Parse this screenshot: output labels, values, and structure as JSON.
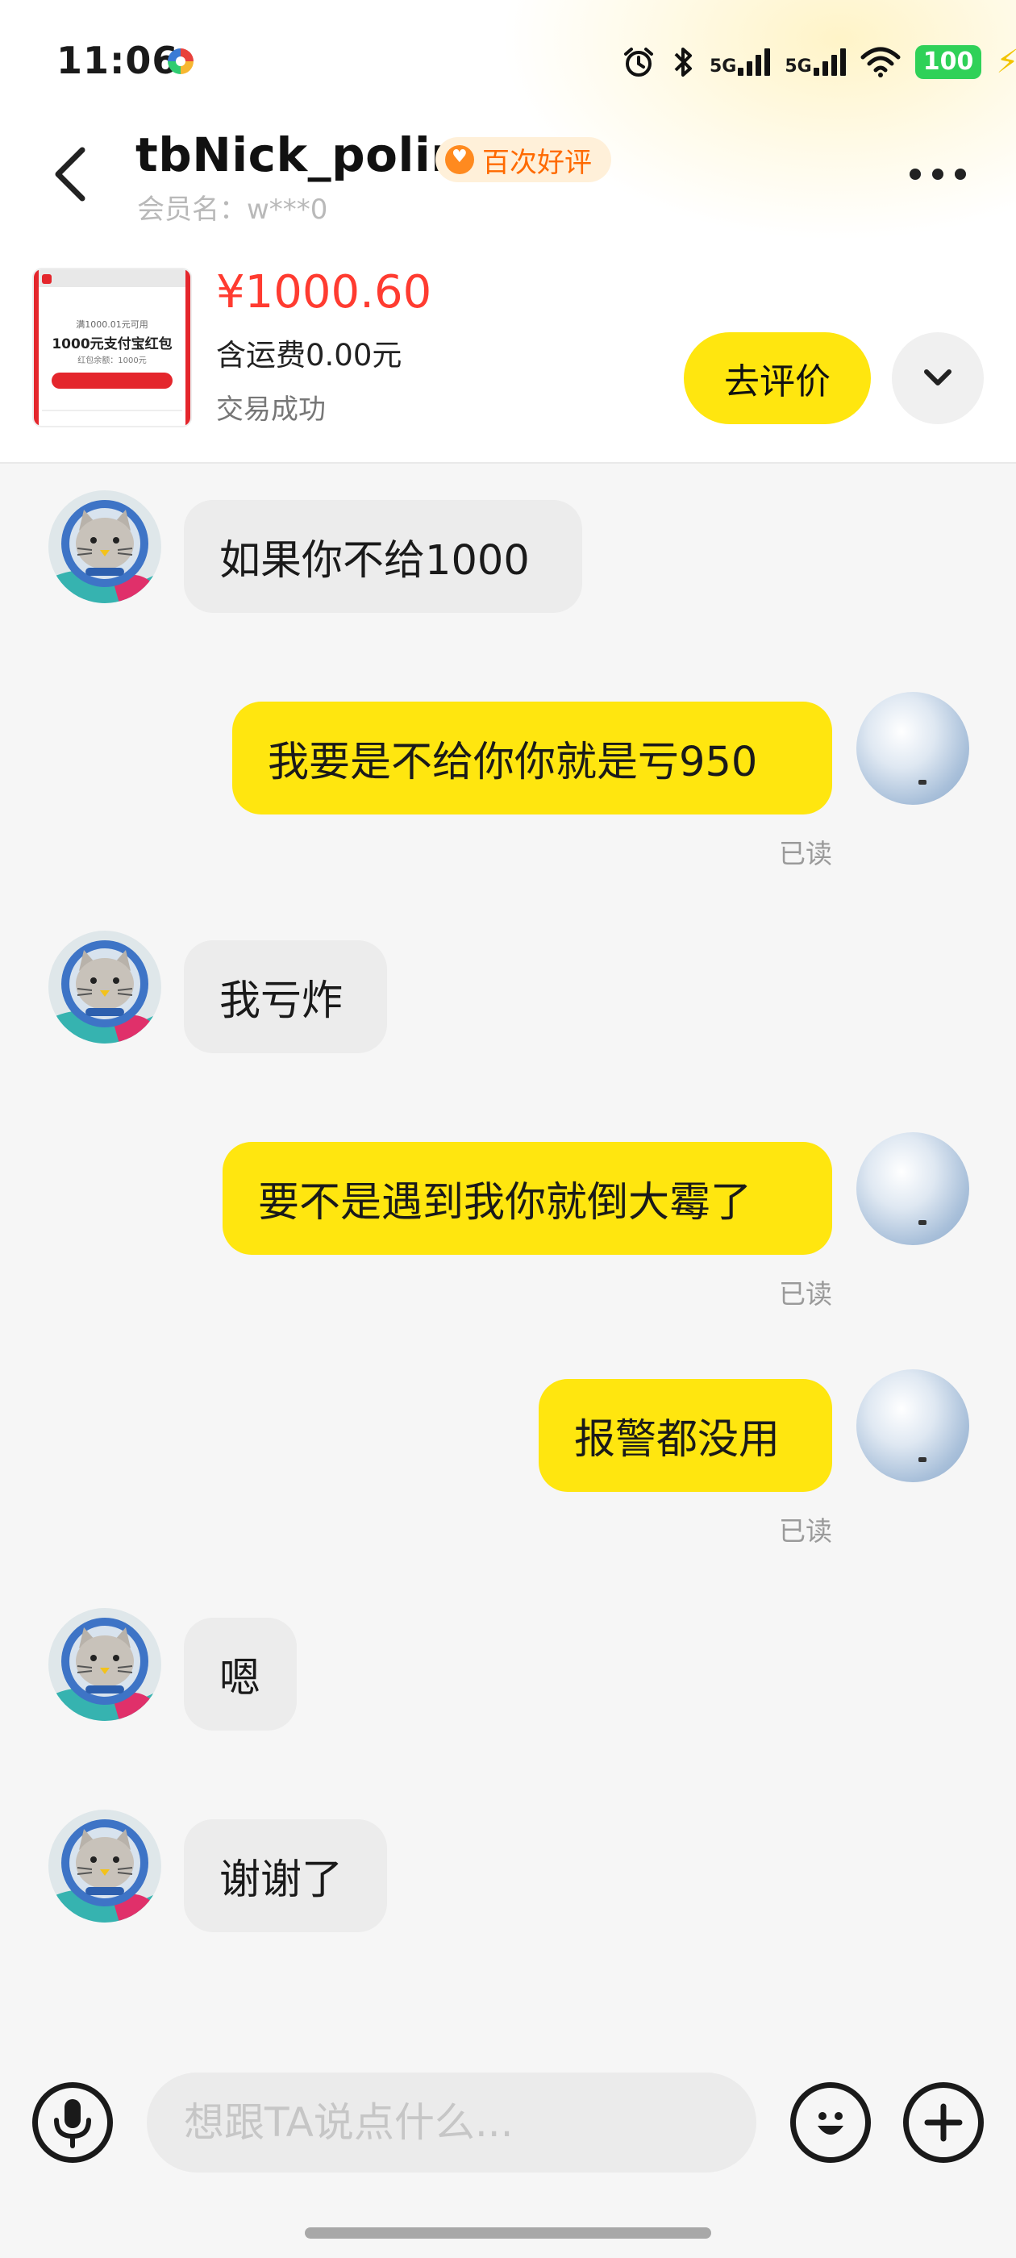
{
  "status_bar": {
    "time": "11:06",
    "signal_1": "5G",
    "signal_2": "5G",
    "battery": "100"
  },
  "header": {
    "nickname": "tbNick_polir",
    "badge": "百次好评",
    "member_name": "会员名：w***0"
  },
  "product": {
    "thumb_line1": "满1000.01元可用",
    "thumb_line2": "1000元支付宝红包",
    "thumb_line3": "红包余额：1000元",
    "price": "¥1000.60",
    "shipping": "含运费0.00元",
    "status": "交易成功",
    "review_button": "去评价"
  },
  "messages": [
    {
      "side": "in",
      "text": "如果你不给1000"
    },
    {
      "side": "out",
      "text": "我要是不给你你就是亏950",
      "read": "已读"
    },
    {
      "side": "in",
      "text": "我亏炸"
    },
    {
      "side": "out",
      "text": "要不是遇到我你就倒大霉了",
      "read": "已读"
    },
    {
      "side": "out",
      "text": "报警都没用",
      "read": "已读"
    },
    {
      "side": "in",
      "text": "嗯"
    },
    {
      "side": "in",
      "text": "谢谢了"
    }
  ],
  "input": {
    "placeholder": "想跟TA说点什么..."
  },
  "colors": {
    "accent_yellow": "#ffe60f",
    "price_red": "#ff3b30",
    "badge_orange": "#ff6a00",
    "incoming_bubble": "#ececec"
  },
  "icons": [
    "back-icon",
    "more-icon",
    "chevron-down-icon",
    "microphone-icon",
    "emoji-icon",
    "plus-icon",
    "cat-avatar",
    "sky-avatar"
  ]
}
